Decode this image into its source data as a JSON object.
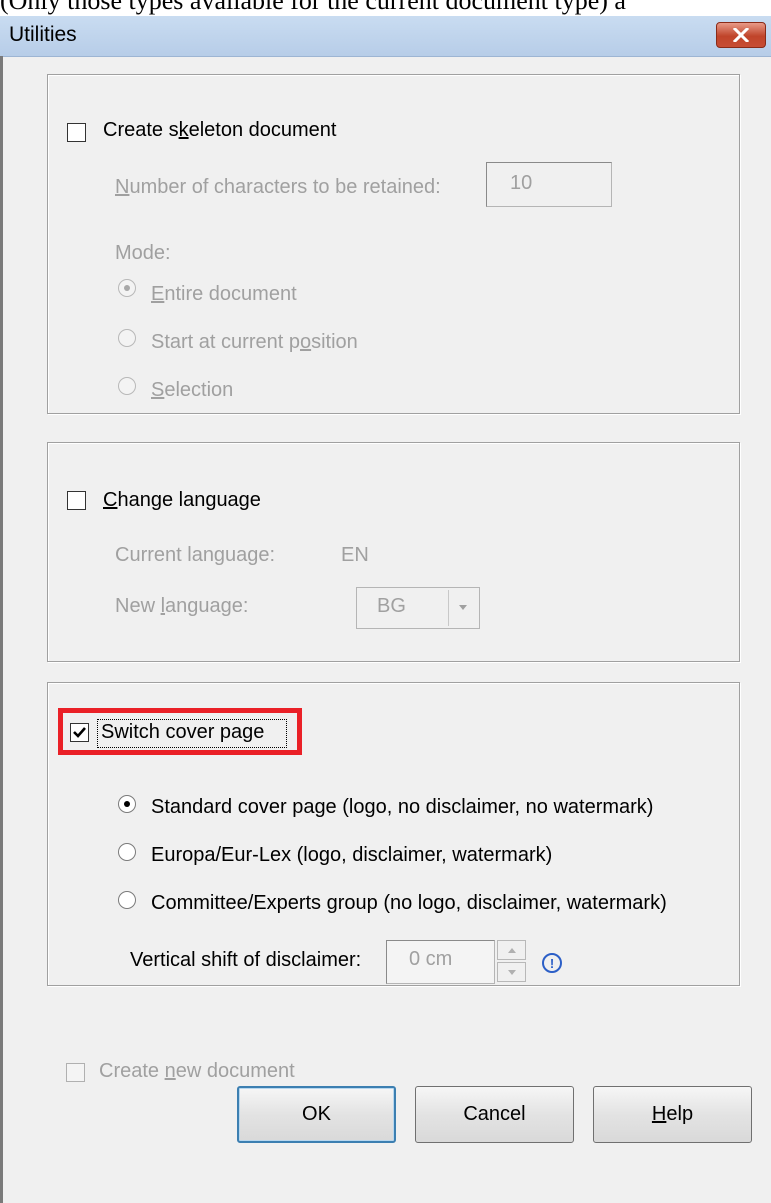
{
  "backdrop": {
    "text": "(Only those types available for the current document type) a"
  },
  "window": {
    "title": "Utilities"
  },
  "skeleton": {
    "checkbox_label_pre": "Create s",
    "checkbox_label_key": "k",
    "checkbox_label_post": "eleton document",
    "checked": false,
    "chars_label_key": "N",
    "chars_label_post": "umber of characters to be retained:",
    "chars_value": "10",
    "mode_label": "Mode:",
    "options": [
      {
        "key": "E",
        "rest": "ntire document",
        "selected": true
      },
      {
        "pre": "Start at current p",
        "key": "o",
        "rest": "sition",
        "selected": false
      },
      {
        "key": "S",
        "rest": "election",
        "selected": false
      }
    ]
  },
  "language": {
    "checkbox_key": "C",
    "checkbox_rest": "hange language",
    "checked": false,
    "current_label": "Current language:",
    "current_value": "EN",
    "new_label_pre": "New ",
    "new_label_key": "l",
    "new_label_post": "anguage:",
    "new_value": "BG"
  },
  "cover": {
    "checkbox_label": "Switch cover page",
    "checked": true,
    "options": [
      {
        "label": "Standard cover page (logo, no disclaimer, no watermark)",
        "selected": true
      },
      {
        "label": "Europa/Eur-Lex (logo, disclaimer, watermark)",
        "selected": false
      },
      {
        "label": "Committee/Experts group (no logo, disclaimer, watermark)",
        "selected": false
      }
    ],
    "vshift_label": "Vertical shift of disclaimer:",
    "vshift_value": "0 cm",
    "info_glyph": "!"
  },
  "new_document": {
    "label_pre": "Create ",
    "label_key": "n",
    "label_post": "ew document",
    "checked": false
  },
  "buttons": {
    "ok": "OK",
    "cancel": "Cancel",
    "help_key": "H",
    "help_rest": "elp"
  },
  "colors": {
    "highlight": "#ea2027",
    "titlebar": "#c9dcf1",
    "close": "#c0442a"
  }
}
